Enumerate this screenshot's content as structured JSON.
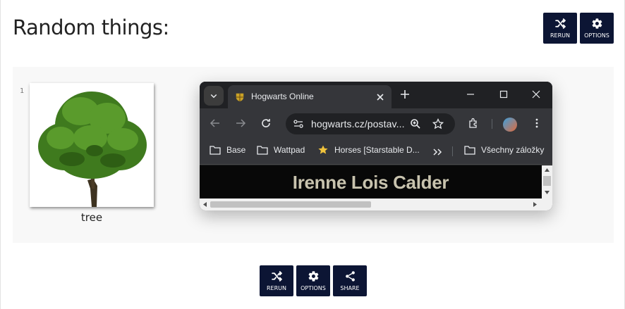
{
  "page": {
    "title": "Random things:"
  },
  "top_buttons": {
    "rerun_label": "RERUN",
    "options_label": "OPTIONS"
  },
  "results": [
    {
      "number": "1",
      "image_icon": "tree-icon",
      "label": "tree"
    }
  ],
  "browser": {
    "tab_title": "Hogwarts Online",
    "url": "hogwarts.cz/postav...",
    "bookmarks": [
      {
        "label": "Base",
        "icon": "folder-icon"
      },
      {
        "label": "Wattpad",
        "icon": "folder-icon"
      },
      {
        "label": "Horses [Starstable D...",
        "icon": "star-icon"
      },
      {
        "label": "Všechny záložky",
        "icon": "folder-icon"
      }
    ],
    "content_heading": "Irenne Lois Calder"
  },
  "bottom_buttons": {
    "rerun_label": "RERUN",
    "options_label": "OPTIONS",
    "share_label": "SHARE"
  },
  "colors": {
    "button_bg": "#0c1534",
    "panel_bg": "#f8f8f8",
    "browser_frame": "#202124",
    "browser_toolbar": "#35363a",
    "content_text": "#c8c3ae"
  }
}
